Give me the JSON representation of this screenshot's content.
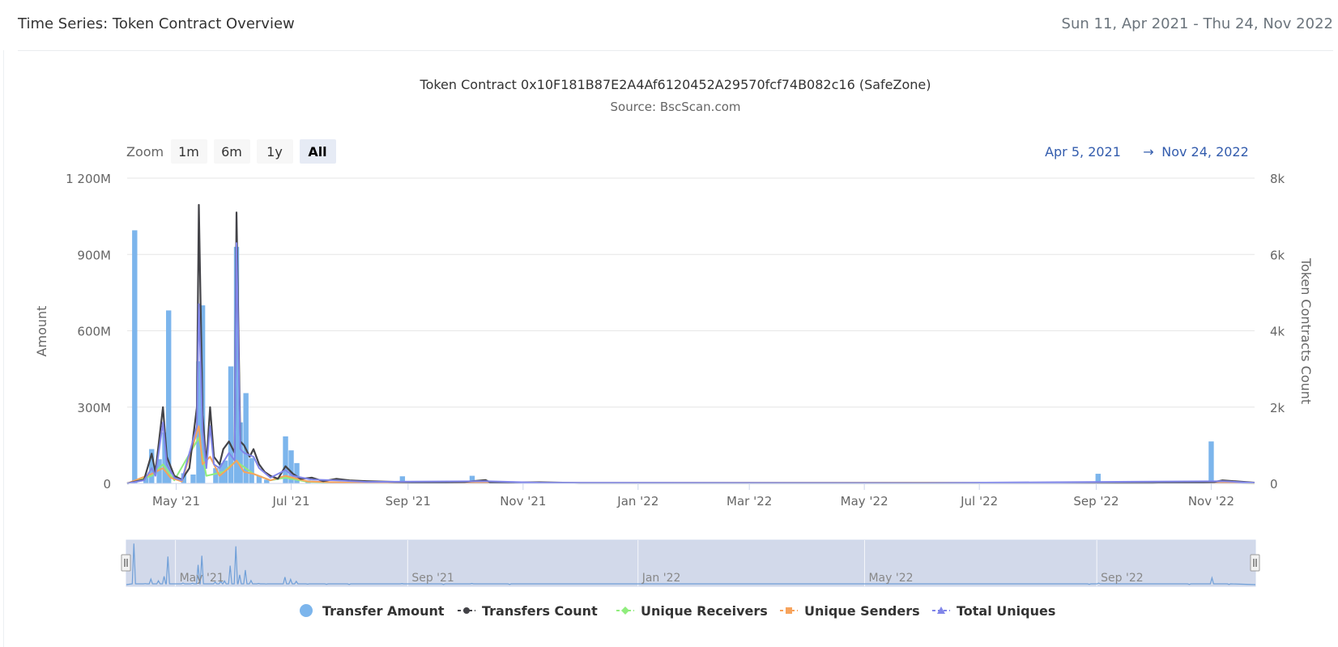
{
  "header": {
    "title": "Time Series: Token Contract Overview",
    "date_range": "Sun 11, Apr 2021 - Thu 24, Nov 2022"
  },
  "chart_data": {
    "type": "bar",
    "title": "Token Contract 0x10F181B87E2A4Af6120452A29570fcf74B082c16 (SafeZone)",
    "subtitle": "Source: BscScan.com",
    "ylabel": "Amount",
    "y2label": "Token Contracts Count",
    "ylim": [
      0,
      1200000000
    ],
    "y2lim": [
      0,
      8000
    ],
    "y_ticks": [
      "0",
      "300M",
      "600M",
      "900M",
      "1 200M"
    ],
    "y2_ticks": [
      "0",
      "2k",
      "4k",
      "6k",
      "8k"
    ],
    "x_ticks": [
      "May '21",
      "Jul '21",
      "Sep '21",
      "Nov '21",
      "Jan '22",
      "Mar '22",
      "May '22",
      "Jul '22",
      "Sep '22",
      "Nov '22"
    ],
    "x_range": [
      "2021-04-05",
      "2022-11-24"
    ],
    "grid": true,
    "legend_position": "bottom",
    "series": [
      {
        "name": "Transfer Amount",
        "type": "column",
        "axis": "left",
        "color": "#7cb5ec",
        "points": [
          [
            "2021-04-09",
            995000000
          ],
          [
            "2021-04-15",
            25000000
          ],
          [
            "2021-04-18",
            135000000
          ],
          [
            "2021-04-22",
            95000000
          ],
          [
            "2021-04-25",
            200000000
          ],
          [
            "2021-04-27",
            680000000
          ],
          [
            "2021-05-05",
            40000000
          ],
          [
            "2021-05-10",
            35000000
          ],
          [
            "2021-05-13",
            480000000
          ],
          [
            "2021-05-15",
            700000000
          ],
          [
            "2021-05-22",
            60000000
          ],
          [
            "2021-05-25",
            80000000
          ],
          [
            "2021-05-27",
            90000000
          ],
          [
            "2021-05-30",
            460000000
          ],
          [
            "2021-06-02",
            930000000
          ],
          [
            "2021-06-04",
            240000000
          ],
          [
            "2021-06-07",
            355000000
          ],
          [
            "2021-06-10",
            100000000
          ],
          [
            "2021-06-14",
            30000000
          ],
          [
            "2021-06-18",
            15000000
          ],
          [
            "2021-06-28",
            185000000
          ],
          [
            "2021-07-01",
            130000000
          ],
          [
            "2021-07-04",
            80000000
          ],
          [
            "2021-07-10",
            12000000
          ],
          [
            "2021-07-20",
            8000000
          ],
          [
            "2021-08-01",
            6000000
          ],
          [
            "2021-08-29",
            28000000
          ],
          [
            "2021-09-20",
            5000000
          ],
          [
            "2021-10-05",
            30000000
          ],
          [
            "2021-10-25",
            5000000
          ],
          [
            "2022-08-28",
            8000000
          ],
          [
            "2022-09-02",
            38000000
          ],
          [
            "2022-10-20",
            6000000
          ],
          [
            "2022-11-01",
            165000000
          ],
          [
            "2022-11-10",
            5000000
          ]
        ]
      },
      {
        "name": "Transfers Count",
        "type": "line",
        "axis": "right",
        "color": "#434348",
        "marker": "circle",
        "points": [
          [
            "2021-04-05",
            0
          ],
          [
            "2021-04-14",
            100
          ],
          [
            "2021-04-18",
            780
          ],
          [
            "2021-04-20",
            300
          ],
          [
            "2021-04-24",
            2000
          ],
          [
            "2021-04-26",
            700
          ],
          [
            "2021-04-30",
            200
          ],
          [
            "2021-05-04",
            100
          ],
          [
            "2021-05-08",
            400
          ],
          [
            "2021-05-12",
            2000
          ],
          [
            "2021-05-13",
            7300
          ],
          [
            "2021-05-15",
            1800
          ],
          [
            "2021-05-17",
            500
          ],
          [
            "2021-05-19",
            2000
          ],
          [
            "2021-05-21",
            700
          ],
          [
            "2021-05-24",
            500
          ],
          [
            "2021-05-26",
            900
          ],
          [
            "2021-05-29",
            1100
          ],
          [
            "2021-06-01",
            800
          ],
          [
            "2021-06-02",
            7100
          ],
          [
            "2021-06-04",
            1100
          ],
          [
            "2021-06-06",
            1000
          ],
          [
            "2021-06-09",
            700
          ],
          [
            "2021-06-11",
            900
          ],
          [
            "2021-06-14",
            500
          ],
          [
            "2021-06-17",
            300
          ],
          [
            "2021-06-20",
            200
          ],
          [
            "2021-06-24",
            120
          ],
          [
            "2021-06-28",
            450
          ],
          [
            "2021-07-02",
            250
          ],
          [
            "2021-07-06",
            120
          ],
          [
            "2021-07-12",
            150
          ],
          [
            "2021-07-18",
            60
          ],
          [
            "2021-07-25",
            120
          ],
          [
            "2021-08-01",
            80
          ],
          [
            "2021-08-10",
            60
          ],
          [
            "2021-08-25",
            40
          ],
          [
            "2021-09-10",
            30
          ],
          [
            "2021-10-01",
            40
          ],
          [
            "2021-10-12",
            90
          ],
          [
            "2021-10-15",
            20
          ],
          [
            "2021-11-10",
            30
          ],
          [
            "2021-12-01",
            10
          ],
          [
            "2022-06-01",
            10
          ],
          [
            "2022-10-01",
            10
          ],
          [
            "2022-11-03",
            40
          ],
          [
            "2022-11-07",
            80
          ],
          [
            "2022-11-24",
            20
          ]
        ]
      },
      {
        "name": "Unique Receivers",
        "type": "line",
        "axis": "right",
        "color": "#90ed7d",
        "marker": "diamond",
        "points": [
          [
            "2021-04-05",
            0
          ],
          [
            "2021-04-18",
            200
          ],
          [
            "2021-04-24",
            500
          ],
          [
            "2021-04-30",
            80
          ],
          [
            "2021-05-13",
            1200
          ],
          [
            "2021-05-17",
            200
          ],
          [
            "2021-05-26",
            300
          ],
          [
            "2021-06-02",
            600
          ],
          [
            "2021-06-04",
            500
          ],
          [
            "2021-06-11",
            250
          ],
          [
            "2021-06-20",
            80
          ],
          [
            "2021-06-28",
            150
          ],
          [
            "2021-07-10",
            40
          ],
          [
            "2021-08-01",
            20
          ],
          [
            "2021-10-12",
            20
          ],
          [
            "2022-11-07",
            20
          ],
          [
            "2022-11-24",
            5
          ]
        ]
      },
      {
        "name": "Unique Senders",
        "type": "line",
        "axis": "right",
        "color": "#f7a35c",
        "marker": "square",
        "points": [
          [
            "2021-04-05",
            0
          ],
          [
            "2021-04-18",
            250
          ],
          [
            "2021-04-24",
            400
          ],
          [
            "2021-04-28",
            150
          ],
          [
            "2021-05-04",
            50
          ],
          [
            "2021-05-13",
            1500
          ],
          [
            "2021-05-15",
            500
          ],
          [
            "2021-05-19",
            700
          ],
          [
            "2021-05-24",
            200
          ],
          [
            "2021-05-29",
            400
          ],
          [
            "2021-06-02",
            600
          ],
          [
            "2021-06-06",
            300
          ],
          [
            "2021-06-11",
            250
          ],
          [
            "2021-06-20",
            80
          ],
          [
            "2021-06-28",
            200
          ],
          [
            "2021-07-10",
            50
          ],
          [
            "2021-08-01",
            20
          ],
          [
            "2021-10-12",
            20
          ],
          [
            "2022-11-07",
            20
          ],
          [
            "2022-11-24",
            5
          ]
        ]
      },
      {
        "name": "Total Uniques",
        "type": "line",
        "axis": "right",
        "color": "#8085e9",
        "marker": "triangle",
        "points": [
          [
            "2021-04-05",
            0
          ],
          [
            "2021-04-14",
            80
          ],
          [
            "2021-04-18",
            400
          ],
          [
            "2021-04-20",
            200
          ],
          [
            "2021-04-24",
            1600
          ],
          [
            "2021-04-26",
            500
          ],
          [
            "2021-04-30",
            150
          ],
          [
            "2021-05-04",
            80
          ],
          [
            "2021-05-12",
            1500
          ],
          [
            "2021-05-13",
            4700
          ],
          [
            "2021-05-15",
            1400
          ],
          [
            "2021-05-17",
            400
          ],
          [
            "2021-05-19",
            1500
          ],
          [
            "2021-05-21",
            500
          ],
          [
            "2021-05-24",
            400
          ],
          [
            "2021-05-29",
            800
          ],
          [
            "2021-06-01",
            600
          ],
          [
            "2021-06-02",
            6300
          ],
          [
            "2021-06-04",
            900
          ],
          [
            "2021-06-06",
            800
          ],
          [
            "2021-06-11",
            700
          ],
          [
            "2021-06-14",
            400
          ],
          [
            "2021-06-20",
            150
          ],
          [
            "2021-06-28",
            350
          ],
          [
            "2021-07-02",
            200
          ],
          [
            "2021-07-12",
            100
          ],
          [
            "2021-07-25",
            80
          ],
          [
            "2021-08-10",
            40
          ],
          [
            "2021-10-12",
            60
          ],
          [
            "2021-11-10",
            20
          ],
          [
            "2022-06-01",
            10
          ],
          [
            "2022-11-07",
            60
          ],
          [
            "2022-11-24",
            15
          ]
        ]
      }
    ]
  },
  "range_selector": {
    "zoom_label": "Zoom",
    "buttons": [
      "1m",
      "6m",
      "1y",
      "All"
    ],
    "selected": "All",
    "from_date": "Apr 5, 2021",
    "arrow": "→",
    "to_date": "Nov 24, 2022"
  },
  "navigator": {
    "labels": [
      "May '21",
      "Sep '21",
      "Jan '22",
      "May '22",
      "Sep '22"
    ],
    "label_dates": [
      "2021-05-01",
      "2021-09-01",
      "2022-01-01",
      "2022-05-01",
      "2022-09-01"
    ]
  },
  "legend_items": [
    "Transfer Amount",
    "Transfers Count",
    "Unique Receivers",
    "Unique Senders",
    "Total Uniques"
  ],
  "colors": {
    "grid": "#e6e6e6",
    "navigator_mask": "#cdd5e8",
    "navigator_series": "#6f9fd8",
    "range_text": "#335cad",
    "button_bg": "#f7f7f7",
    "button_selected_bg": "#e6ebf5"
  }
}
